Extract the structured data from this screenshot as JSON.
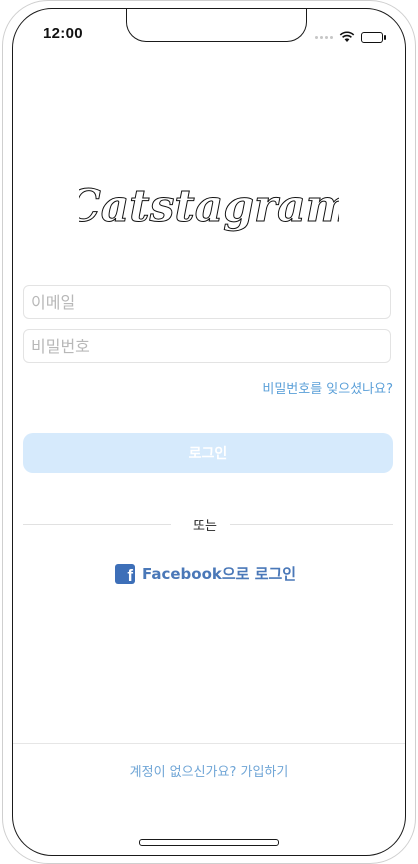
{
  "status_bar": {
    "time": "12:00",
    "wifi_icon": "wifi-icon",
    "battery_icon": "battery-icon"
  },
  "app": {
    "logo_text": "Catstagram"
  },
  "form": {
    "email_placeholder": "이메일",
    "email_value": "",
    "password_placeholder": "비밀번호",
    "password_value": "",
    "forgot_password_label": "비밀번호를 잊으셨나요?",
    "login_button_label": "로그인"
  },
  "divider": {
    "or_label": "또는"
  },
  "facebook": {
    "icon": "facebook-icon",
    "label": "Facebook으로 로그인"
  },
  "footer": {
    "signup_label": "계정이 없으신가요? 가입하기"
  },
  "colors": {
    "accent": "#5a9fd8",
    "login_button_bg": "#d6eafc",
    "facebook_blue": "#3d6fb8"
  }
}
